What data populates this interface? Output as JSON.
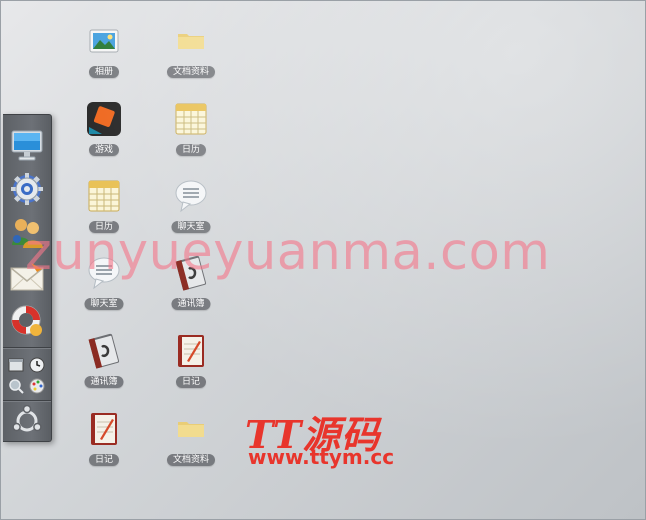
{
  "desktop": {
    "icons": [
      {
        "label": "相册",
        "icon": "photo-album-icon"
      },
      {
        "label": "文档资料",
        "icon": "folder-icon"
      },
      {
        "label": "游戏",
        "icon": "game-icon"
      },
      {
        "label": "日历",
        "icon": "calendar-icon"
      },
      {
        "label": "日历",
        "icon": "calendar-icon"
      },
      {
        "label": "聊天室",
        "icon": "chat-bubble-icon"
      },
      {
        "label": "聊天室",
        "icon": "chat-bubble-icon"
      },
      {
        "label": "通讯簿",
        "icon": "address-book-icon"
      },
      {
        "label": "通讯簿",
        "icon": "address-book-icon"
      },
      {
        "label": "日记",
        "icon": "diary-icon"
      },
      {
        "label": "日记",
        "icon": "diary-icon"
      },
      {
        "label": "文档资料",
        "icon": "folder-icon"
      }
    ]
  },
  "dock": {
    "items": [
      "monitor-icon",
      "settings-gear-icon",
      "users-icon",
      "mail-icon",
      "help-lifebuoy-icon"
    ],
    "mini": [
      "window-icon",
      "clock-icon",
      "search-icon",
      "palette-icon"
    ],
    "start": "ubuntu-logo-icon"
  },
  "watermark": {
    "text": "zunyueyuanma.com",
    "logo_title": "TT源码",
    "logo_url": "www.ttym.cc"
  },
  "colors": {
    "watermark": "#f3788a",
    "logo": "#e8352c",
    "dock": "#66696e"
  }
}
